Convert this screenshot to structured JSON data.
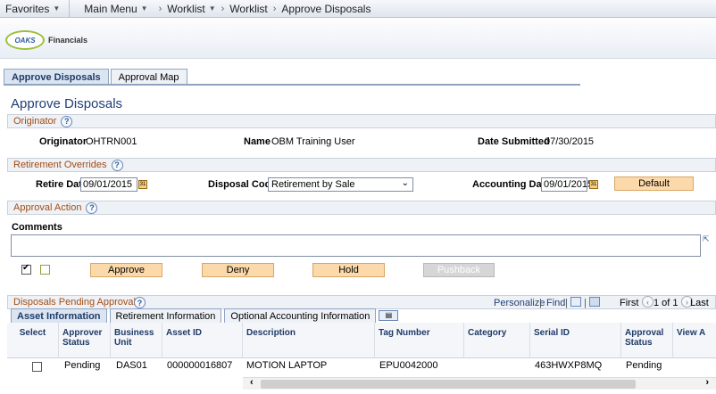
{
  "nav": {
    "favorites": "Favorites",
    "main_menu": "Main Menu",
    "worklist1": "Worklist",
    "worklist2": "Worklist",
    "current": "Approve Disposals"
  },
  "logo": {
    "mark": "OAKS",
    "text": "Financials"
  },
  "tabs": [
    "Approve Disposals",
    "Approval Map"
  ],
  "page_title": "Approve Disposals",
  "originator_section": {
    "header": "Originator",
    "originator_label": "Originator",
    "originator_value": "OHTRN001",
    "name_label": "Name",
    "name_value": "OBM Training User",
    "date_label": "Date Submitted",
    "date_value": "07/30/2015"
  },
  "overrides_section": {
    "header": "Retirement Overrides",
    "retire_label": "Retire Date",
    "retire_value": "09/01/2015",
    "disposal_label": "Disposal Code",
    "disposal_value": "Retirement by Sale",
    "acct_label": "Accounting Date",
    "acct_value": "09/01/2015",
    "default_btn": "Default"
  },
  "approval_section": {
    "header": "Approval Action",
    "comments_label": "Comments",
    "approve_btn": "Approve",
    "deny_btn": "Deny",
    "hold_btn": "Hold",
    "pushback_btn": "Pushback"
  },
  "pending_section": {
    "header": "Disposals Pending Approval",
    "personalize": "Personalize",
    "find": "Find",
    "first": "First",
    "pager": "1 of 1",
    "last": "Last",
    "grid_tabs": [
      "Asset Information",
      "Retirement Information",
      "Optional Accounting Information"
    ],
    "columns": [
      "Select",
      "Approver Status",
      "Business Unit",
      "Asset ID",
      "Description",
      "Tag Number",
      "Category",
      "Serial ID",
      "Approval Status",
      "View A"
    ],
    "row": {
      "approver_status": "Pending",
      "business_unit": "DAS01",
      "asset_id": "000000016807",
      "description": "MOTION LAPTOP",
      "tag_number": "EPU0042000",
      "category": "",
      "serial_id": "463HWXP8MQ",
      "approval_status": "Pending"
    }
  }
}
